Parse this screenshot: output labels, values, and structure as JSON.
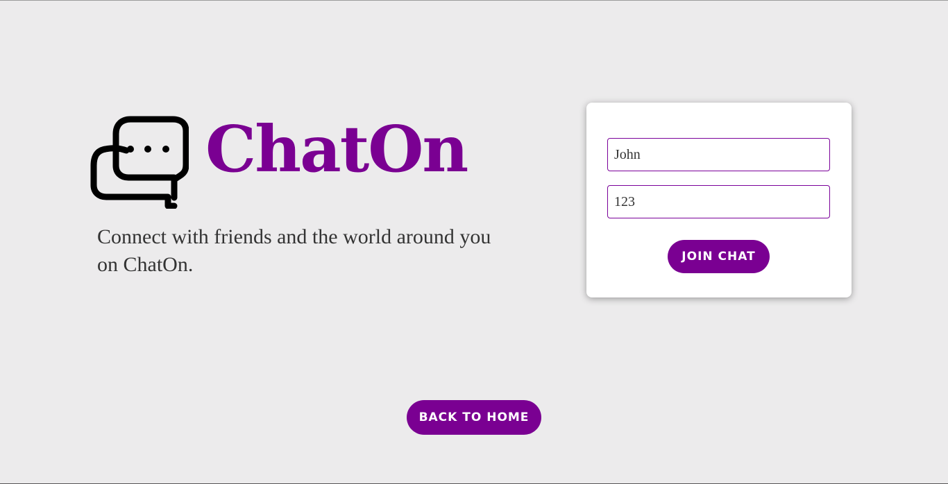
{
  "colors": {
    "background": "#ecebec",
    "brand": "#7a0092",
    "button": "#7a0092",
    "input_border": "#7a0099",
    "text": "#333333"
  },
  "brand": {
    "icon": "chat-bubbles-icon",
    "name": "ChatOn",
    "tagline": "Connect with friends and the world around you on ChatOn."
  },
  "join_form": {
    "name_value": "John",
    "room_value": "123",
    "join_label": "JOIN CHAT"
  },
  "footer": {
    "back_label": "BACK TO HOME"
  }
}
